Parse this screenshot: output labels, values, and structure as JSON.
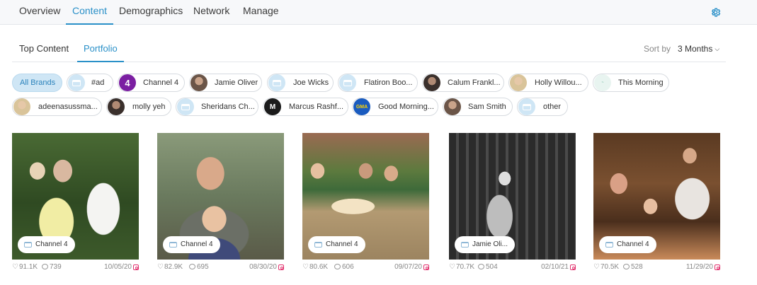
{
  "nav": {
    "tabs": [
      {
        "label": "Overview"
      },
      {
        "label": "Content"
      },
      {
        "label": "Demographics"
      },
      {
        "label": "Network"
      },
      {
        "label": "Manage"
      }
    ],
    "active": "Content",
    "settings_icon": "gear-icon"
  },
  "subnav": {
    "tabs": [
      {
        "label": "Top Content"
      },
      {
        "label": "Portfolio"
      }
    ],
    "active": "Portfolio",
    "sort_label": "Sort by",
    "sort_value": "3 Months"
  },
  "brands": [
    {
      "label": "All Brands",
      "active": true
    },
    {
      "label": "#ad"
    },
    {
      "label": "Channel 4"
    },
    {
      "label": "Jamie Oliver"
    },
    {
      "label": "Joe Wicks"
    },
    {
      "label": "Flatiron Boo..."
    },
    {
      "label": "Calum Frankl..."
    },
    {
      "label": "Holly Willou..."
    },
    {
      "label": "This Morning"
    },
    {
      "label": "adeenasussma..."
    },
    {
      "label": "molly yeh"
    },
    {
      "label": "Sheridans Ch..."
    },
    {
      "label": "Marcus Rashf..."
    },
    {
      "label": "Good Morning..."
    },
    {
      "label": "Sam Smith"
    },
    {
      "label": "other"
    }
  ],
  "posts": [
    {
      "brand": "Channel 4",
      "likes": "91.1K",
      "comments": "739",
      "date": "10/05/20"
    },
    {
      "brand": "Channel 4",
      "likes": "82.9K",
      "comments": "695",
      "date": "08/30/20"
    },
    {
      "brand": "Channel 4",
      "likes": "80.6K",
      "comments": "606",
      "date": "09/07/20"
    },
    {
      "brand": "Jamie Oli...",
      "likes": "70.7K",
      "comments": "504",
      "date": "02/10/21"
    },
    {
      "brand": "Channel 4",
      "likes": "70.5K",
      "comments": "528",
      "date": "11/29/20"
    }
  ],
  "colors": {
    "accent": "#2a90c8",
    "chip_active_bg": "#cfe6f5",
    "instagram": "#e1306c"
  }
}
